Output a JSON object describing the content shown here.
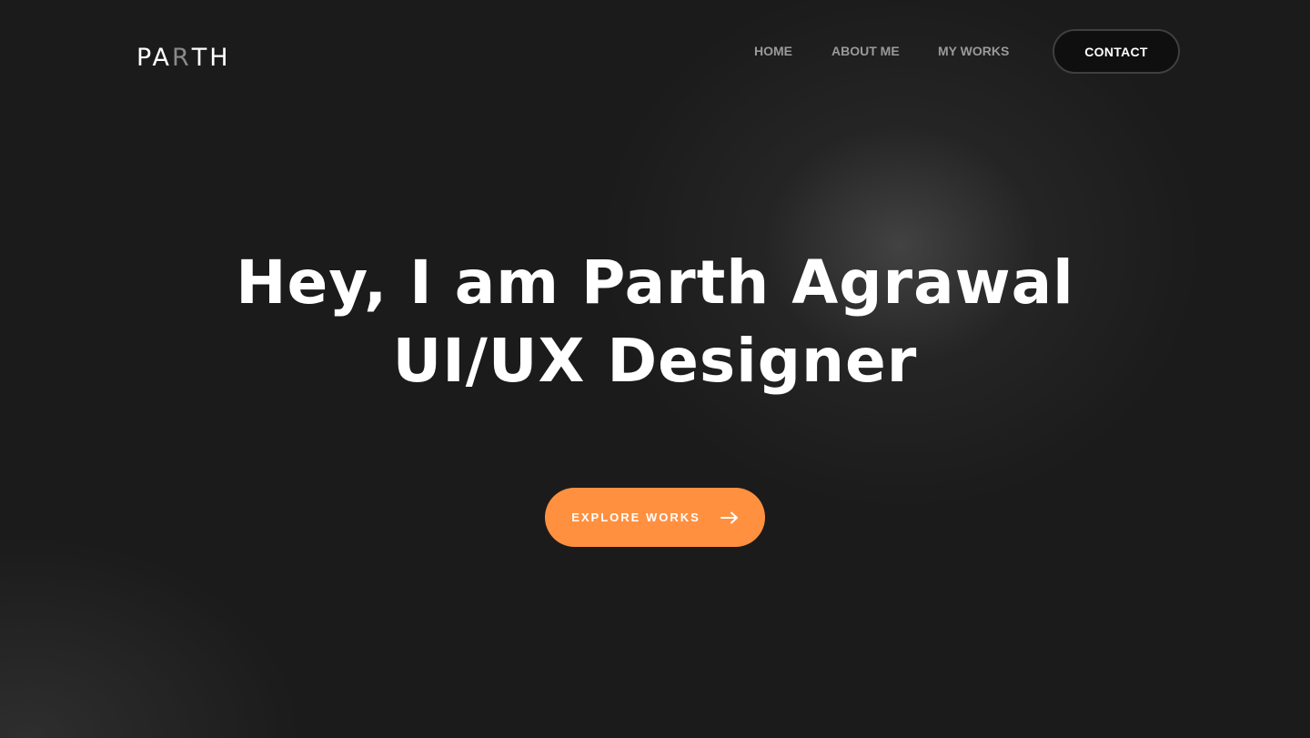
{
  "logo": {
    "prefix": "PA",
    "accent": "R",
    "suffix": "TH"
  },
  "nav": {
    "home": "HOME",
    "about": "ABOUT ME",
    "works": "MY WORKS",
    "contact": "CONTACT"
  },
  "hero": {
    "line1": "Hey, I am Parth Agrawal",
    "line2": "UI/UX Designer"
  },
  "cta": {
    "label": "EXPLORE WORKS",
    "icon": "arrow-right-icon",
    "color": "#ff9040"
  },
  "colors": {
    "background": "#1b1b1b",
    "accent": "#ff9040",
    "nav_text": "#9a9a9a"
  }
}
